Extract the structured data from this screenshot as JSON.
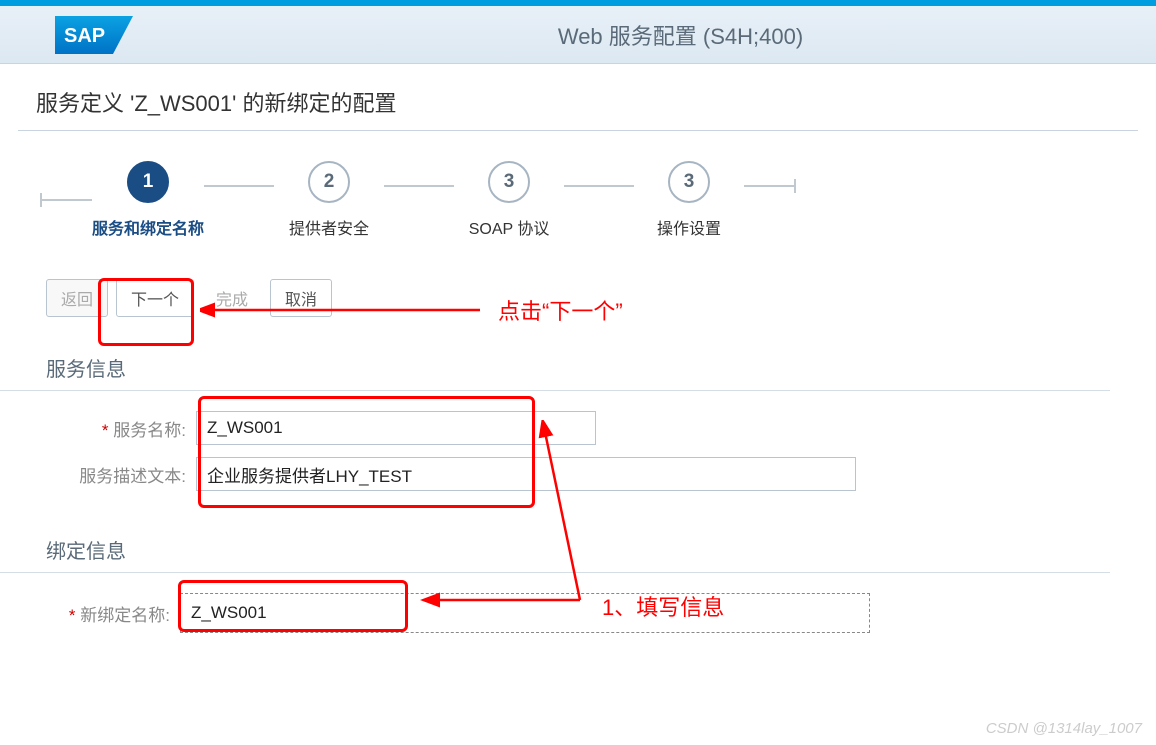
{
  "header": {
    "title": "Web 服务配置 (S4H;400)",
    "logo_text": "SAP"
  },
  "page_title": "服务定义 'Z_WS001' 的新绑定的配置",
  "roadmap": {
    "steps": [
      {
        "num": "1",
        "label": "服务和绑定名称",
        "active": true
      },
      {
        "num": "2",
        "label": "提供者安全",
        "active": false
      },
      {
        "num": "3",
        "label": "SOAP 协议",
        "active": false
      },
      {
        "num": "3",
        "label": "操作设置",
        "active": false
      }
    ]
  },
  "toolbar": {
    "back": "返回",
    "next": "下一个",
    "finish": "完成",
    "cancel": "取消"
  },
  "sections": {
    "service_info": {
      "title": "服务信息",
      "service_name_label": "服务名称:",
      "service_name_value": "Z_WS001",
      "service_desc_label": "服务描述文本:",
      "service_desc_value": "企业服务提供者LHY_TEST"
    },
    "binding_info": {
      "title": "绑定信息",
      "binding_name_label": "新绑定名称:",
      "binding_name_value": "Z_WS001"
    }
  },
  "annotations": {
    "click_next": "点击“下一个”",
    "fill_info": "1、填写信息"
  },
  "watermark": "CSDN @1314lay_1007"
}
